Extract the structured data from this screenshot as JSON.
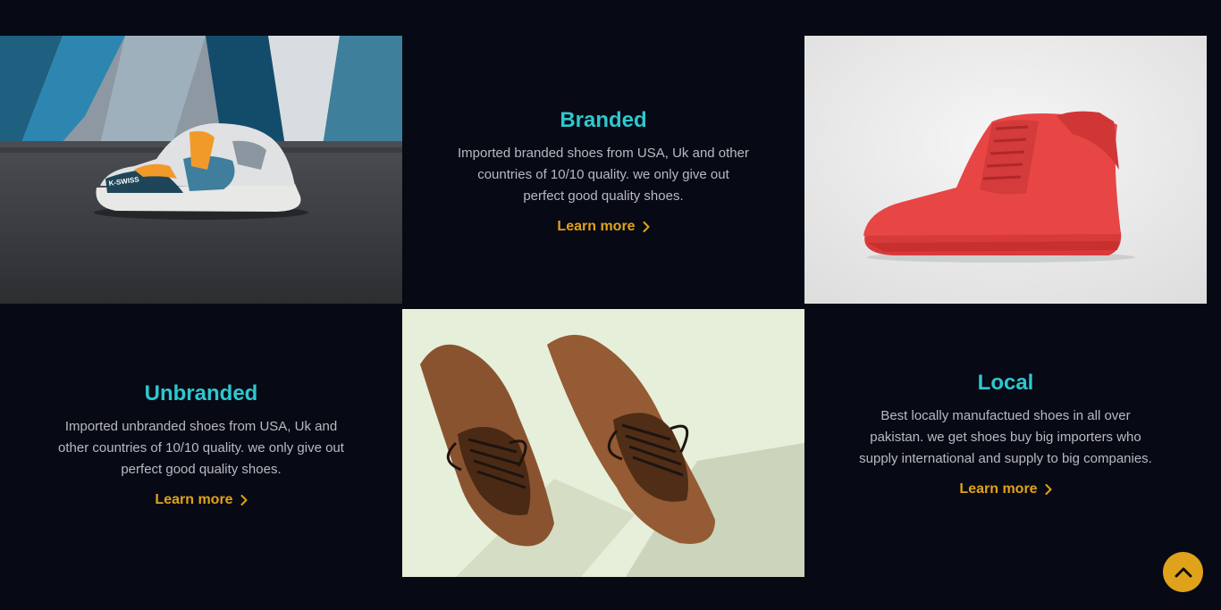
{
  "cards": [
    {
      "title": "Branded",
      "description": "Imported branded shoes from USA, Uk and other countries of 10/10 quality. we only give out perfect good quality shoes.",
      "link_label": "Learn more"
    },
    {
      "title": "Unbranded",
      "description": "Imported unbranded shoes from USA, Uk and other countries of 10/10 quality. we only give out perfect good quality shoes.",
      "link_label": "Learn more"
    },
    {
      "title": "Local",
      "description": "Best locally manufactued shoes in all over pakistan. we get shoes buy big importers who supply international and supply to big companies.",
      "link_label": "Learn more"
    }
  ],
  "images": {
    "sneaker_brand": "K-SWISS"
  },
  "colors": {
    "background": "#070914",
    "title": "#2ec7cf",
    "accent": "#e0a21a",
    "text": "#b8bac2"
  },
  "icons": {
    "link_arrow": "chevron-right-icon",
    "back_to_top": "chevron-up-icon"
  }
}
